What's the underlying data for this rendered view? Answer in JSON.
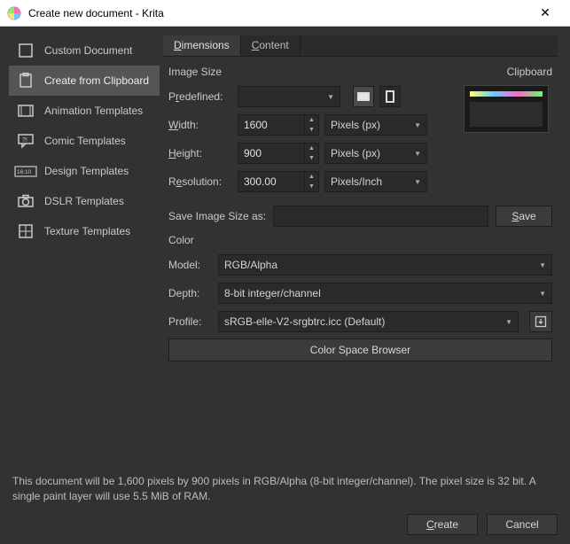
{
  "window": {
    "title": "Create new document - Krita"
  },
  "sidebar": {
    "items": [
      {
        "label": "Custom Document"
      },
      {
        "label": "Create from Clipboard"
      },
      {
        "label": "Animation Templates"
      },
      {
        "label": "Comic Templates"
      },
      {
        "label": "Design Templates"
      },
      {
        "label": "DSLR Templates"
      },
      {
        "label": "Texture Templates"
      }
    ]
  },
  "tabs": {
    "dimensions_pre": "",
    "dimensions_u": "D",
    "dimensions_post": "imensions",
    "content_pre": "",
    "content_u": "C",
    "content_post": "ontent"
  },
  "imagesize": {
    "heading": "Image Size",
    "predefined_pre": "P",
    "predefined_u": "r",
    "predefined_post": "edefined:",
    "predefined_value": "",
    "width_u": "W",
    "width_post": "idth:",
    "width_value": "1600",
    "width_unit": "Pixels (px)",
    "height_u": "H",
    "height_post": "eight:",
    "height_value": "900",
    "height_unit": "Pixels (px)",
    "resolution_pre": "R",
    "resolution_u": "e",
    "resolution_post": "solution:",
    "resolution_value": "300.00",
    "resolution_unit": "Pixels/Inch"
  },
  "clipboard": {
    "heading": "Clipboard"
  },
  "save": {
    "label": "Save Image Size as:",
    "value": "",
    "button_u": "S",
    "button_post": "ave"
  },
  "color": {
    "heading": "Color",
    "model_label": "Model:",
    "model_value": "RGB/Alpha",
    "depth_label": "Depth:",
    "depth_value": "8-bit integer/channel",
    "profile_label": "Profile:",
    "profile_value": "sRGB-elle-V2-srgbtrc.icc (Default)",
    "browser_button": "Color Space Browser"
  },
  "footer": {
    "info": "This document will be 1,600 pixels by 900 pixels in RGB/Alpha (8-bit integer/channel). The pixel size is 32 bit. A single paint layer will use 5.5 MiB of RAM.",
    "create_u": "C",
    "create_post": "reate",
    "cancel": "Cancel"
  }
}
